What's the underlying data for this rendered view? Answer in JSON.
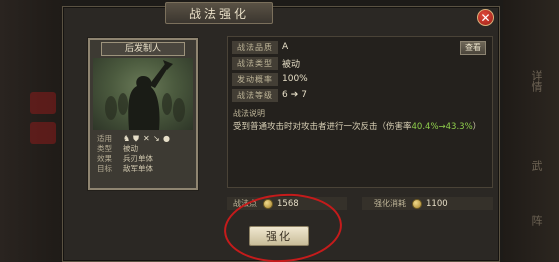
{
  "dialog": {
    "title": "战法强化",
    "close_label": "✕"
  },
  "card": {
    "name": "后发制人",
    "info": [
      {
        "key": "适用",
        "value": ""
      },
      {
        "key": "类型",
        "value": "被动"
      },
      {
        "key": "效果",
        "value": "兵刃单体"
      },
      {
        "key": "目标",
        "value": "敌军单体"
      }
    ],
    "troop_icons": [
      "cavalry-icon",
      "shield-icon",
      "bow-icon",
      "spear-icon",
      "siege-icon"
    ]
  },
  "stats": {
    "quality_label": "战法品质",
    "quality_value": "A",
    "view_button": "查看",
    "type_label": "战法类型",
    "type_value": "被动",
    "rate_label": "发动概率",
    "rate_value": "100%",
    "level_label": "战法等级",
    "level_from": "6",
    "level_to": "7",
    "desc_title": "战法说明",
    "desc_text_prefix": "受到普通攻击时对攻击者进行一次反击（伤害率",
    "desc_highlight": "40.4%→43.3%",
    "desc_text_suffix": "）"
  },
  "costs": {
    "points_label": "战法点",
    "points_value": "1568",
    "cost_label": "强化消耗",
    "cost_value": "1100"
  },
  "enhance_button": "强化",
  "background": {
    "left_tags": [
      "",
      ""
    ],
    "right_labels": [
      "详情",
      "武",
      "阵"
    ]
  },
  "colors": {
    "highlight_green": "#8fcf4c",
    "annotation_red": "#c51b1b",
    "close_red": "#c2291f"
  }
}
